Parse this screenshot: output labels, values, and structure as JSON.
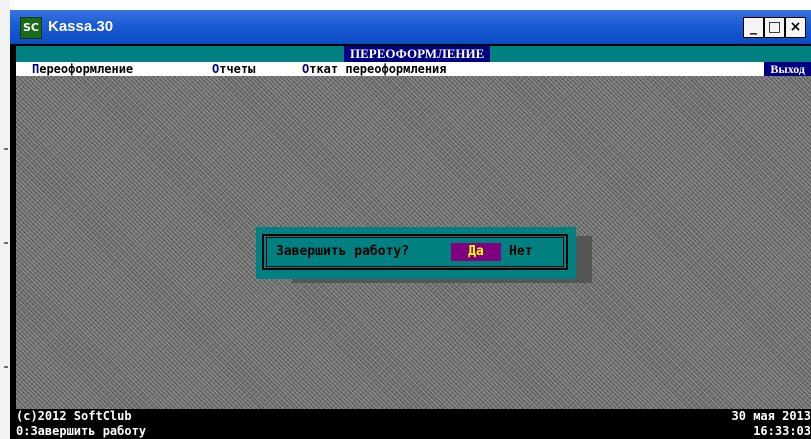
{
  "window": {
    "icon": "SC",
    "title": "Kassa.30",
    "minimize_glyph": "_",
    "maximize_glyph": "□",
    "close_glyph": "×"
  },
  "header": {
    "title": "ПЕРЕОФОРМЛЕНИЕ"
  },
  "menu": {
    "items": [
      {
        "hot": "П",
        "rest": "ереоформление"
      },
      {
        "hot": "О",
        "rest": "тчеты"
      },
      {
        "hot": "О",
        "rest": "ткат переоформления"
      }
    ],
    "exit_label": "Выход"
  },
  "dialog": {
    "question": "Завершить работу?",
    "yes_label": "Да",
    "no_label": "Нет"
  },
  "status": {
    "copyright": "(c)2012 SoftClub",
    "hint": "0:Завершить работу",
    "date": "30 мая 2013",
    "time": "16:33:03"
  },
  "colors": {
    "teal": "#008080",
    "navy": "#000080",
    "purple": "#800080",
    "yellow": "#ffff00",
    "titlebar_blue": "#1d5dd6"
  }
}
